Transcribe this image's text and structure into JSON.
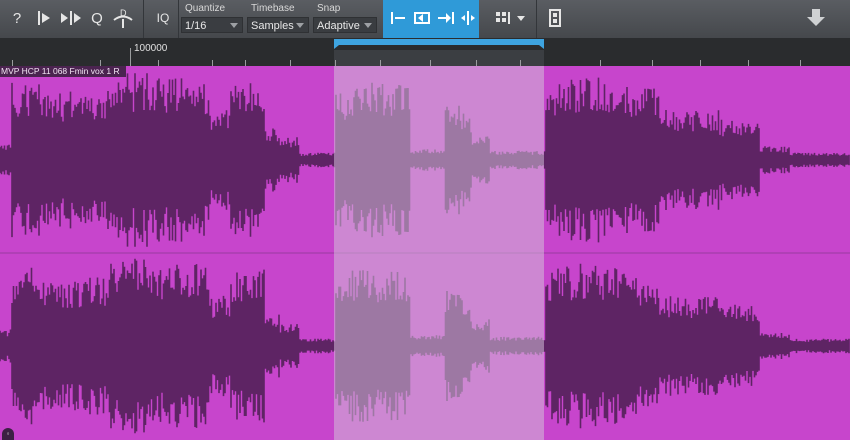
{
  "toolbar": {
    "help_icon": "question-icon",
    "iq_label": "IQ",
    "quantize": {
      "label": "Quantize",
      "value": "1/16"
    },
    "timebase": {
      "label": "Timebase",
      "value": "Samples"
    },
    "snap": {
      "label": "Snap",
      "value": "Adaptive"
    }
  },
  "ruler": {
    "position_label": "100000"
  },
  "event": {
    "name": "MVP HCP 11 068 Fmin vox 1 R"
  },
  "colors": {
    "event_bg": "#c745cc",
    "waveform": "#5e2464",
    "selection": "#d2bed7",
    "toolbar_accent": "#2f9ad8",
    "loop_marker": "#3ea4e0"
  }
}
